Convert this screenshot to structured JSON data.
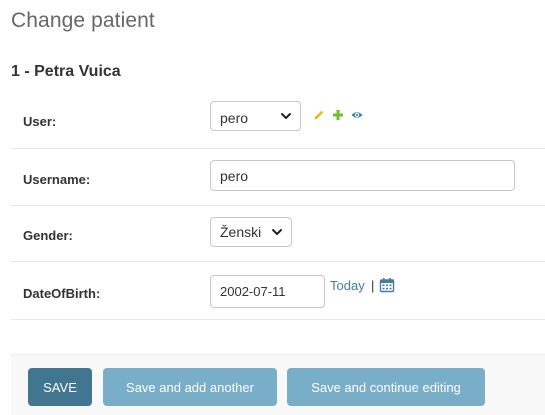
{
  "page": {
    "title": "Change patient",
    "object_heading": "1 - Petra Vuica"
  },
  "fields": {
    "user": {
      "label": "User:",
      "value": "pero",
      "related_icons": [
        "pencil-icon",
        "plus-icon",
        "eye-icon"
      ]
    },
    "username": {
      "label": "Username:",
      "value": "pero"
    },
    "gender": {
      "label": "Gender:",
      "value": "Ženski"
    },
    "date_of_birth": {
      "label": "DateOfBirth:",
      "value": "2002-07-11",
      "today_link": "Today",
      "separator": "|",
      "calendar_icon": "calendar-icon"
    }
  },
  "actions": {
    "save": "Save",
    "save_add_another": "Save and add another",
    "save_continue": "Save and continue editing"
  },
  "colors": {
    "primary_button": "#417690",
    "secondary_button": "#79aec8",
    "link": "#447e9b",
    "pencil_icon": "#efb80b",
    "plus_icon": "#70bf2b",
    "eye_icon": "#447e9b"
  }
}
